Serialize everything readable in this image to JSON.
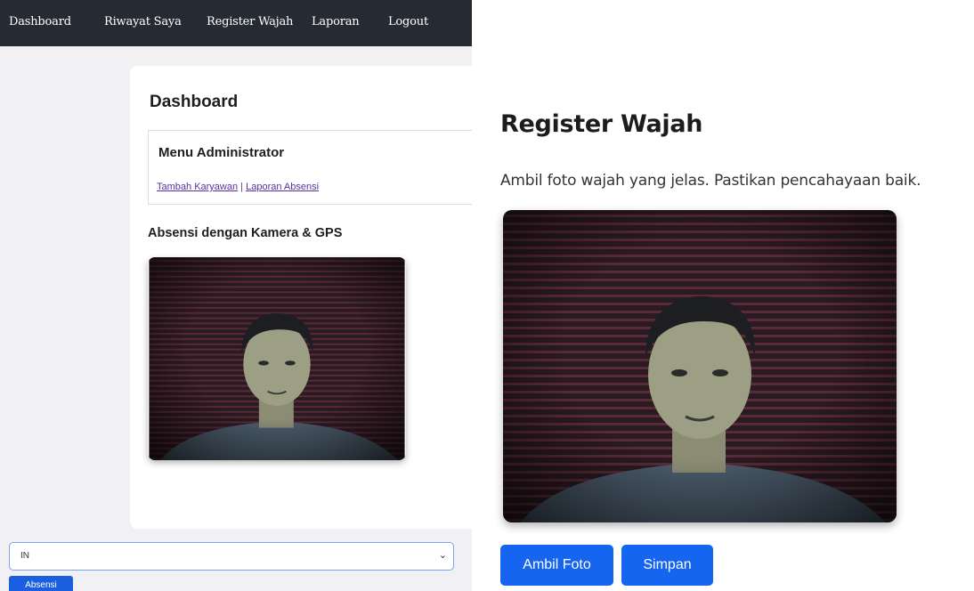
{
  "nav": {
    "items": [
      "Dashboard",
      "Riwayat Saya",
      "Register Wajah",
      "Laporan",
      "Logout"
    ]
  },
  "dashboard": {
    "title": "Dashboard",
    "admin": {
      "title": "Menu Administrator",
      "link_tambah": "Tambah Karyawan",
      "separator": "|",
      "link_laporan": "Laporan Absensi"
    },
    "absensi_title": "Absensi dengan Kamera & GPS",
    "select_value": "IN",
    "submit_label": "Absensi"
  },
  "register": {
    "title": "Register Wajah",
    "description": "Ambil foto wajah yang jelas. Pastikan pencahayaan baik.",
    "capture_label": "Ambil Foto",
    "save_label": "Simpan"
  },
  "colors": {
    "navbar": "#262b33",
    "primary": "#1565f0",
    "link": "#5b2fa6"
  }
}
